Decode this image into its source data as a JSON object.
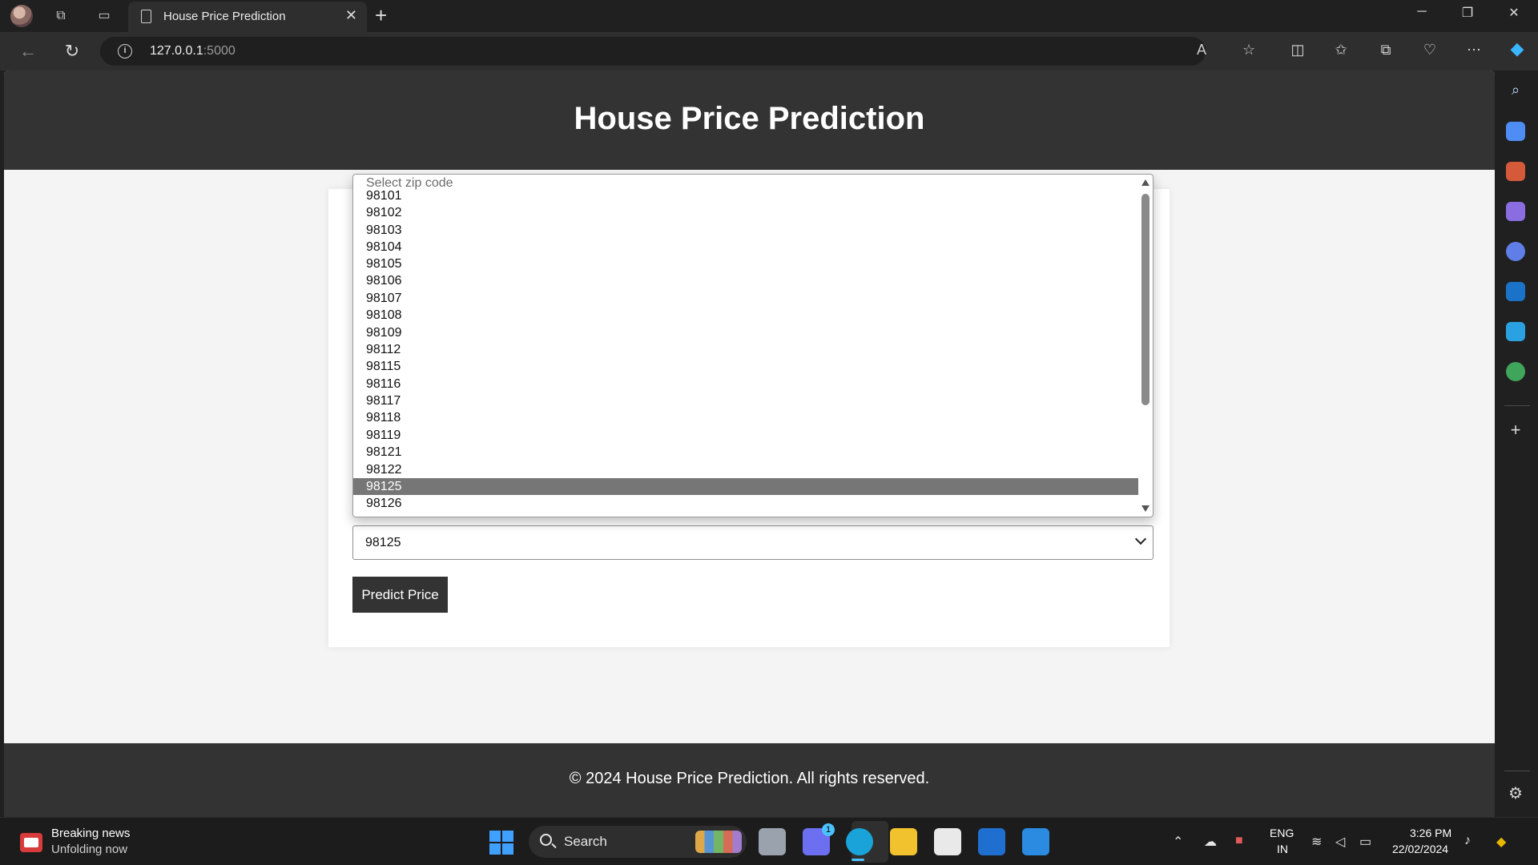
{
  "browser": {
    "tab_title": "House Price Prediction",
    "address_host": "127.0.0.1",
    "address_port": ":5000"
  },
  "page": {
    "title": "House Price Prediction",
    "footer": "© 2024 House Price Prediction. All rights reserved.",
    "predict_button": "Predict Price",
    "zip_select": {
      "value": "98125",
      "placeholder": "Select zip code",
      "options_visible": [
        "98101",
        "98102",
        "98103",
        "98104",
        "98105",
        "98106",
        "98107",
        "98108",
        "98109",
        "98112",
        "98115",
        "98116",
        "98117",
        "98118",
        "98119",
        "98121",
        "98122",
        "98125",
        "98126"
      ],
      "highlighted": "98125"
    }
  },
  "taskbar": {
    "news_title": "Breaking news",
    "news_subtitle": "Unfolding now",
    "search_label": "Search",
    "lang_top": "ENG",
    "lang_bottom": "IN",
    "time": "3:26 PM",
    "date": "22/02/2024",
    "chat_badge": "1"
  },
  "colors": {
    "header_bg": "#333333",
    "page_bg": "#f4f4f4",
    "button_bg": "#333333",
    "highlight_bg": "#767676"
  }
}
